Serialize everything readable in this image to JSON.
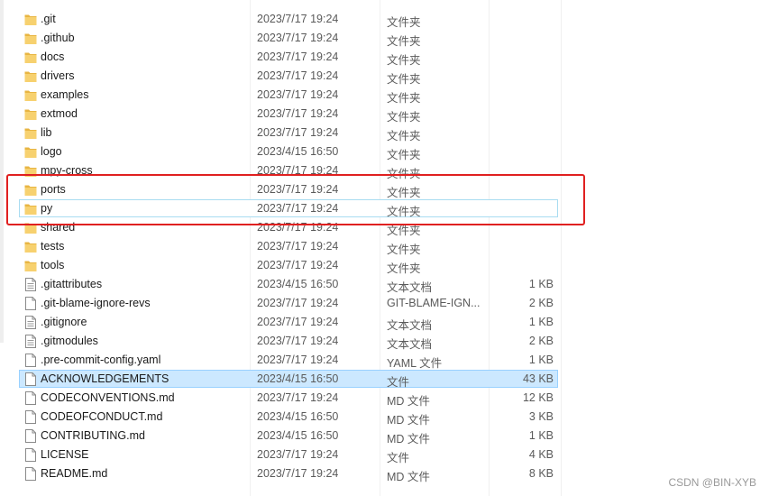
{
  "colors": {
    "folder": "#f7d16f",
    "folder_dark": "#e8b542",
    "selection": "#cce8ff",
    "highlight_box": "#e02020"
  },
  "files": [
    {
      "name": ".git",
      "date": "2023/7/17 19:24",
      "type": "文件夹",
      "size": "",
      "icon": "folder-icon"
    },
    {
      "name": ".github",
      "date": "2023/7/17 19:24",
      "type": "文件夹",
      "size": "",
      "icon": "folder-icon"
    },
    {
      "name": "docs",
      "date": "2023/7/17 19:24",
      "type": "文件夹",
      "size": "",
      "icon": "folder-icon"
    },
    {
      "name": "drivers",
      "date": "2023/7/17 19:24",
      "type": "文件夹",
      "size": "",
      "icon": "folder-icon"
    },
    {
      "name": "examples",
      "date": "2023/7/17 19:24",
      "type": "文件夹",
      "size": "",
      "icon": "folder-icon"
    },
    {
      "name": "extmod",
      "date": "2023/7/17 19:24",
      "type": "文件夹",
      "size": "",
      "icon": "folder-icon"
    },
    {
      "name": "lib",
      "date": "2023/7/17 19:24",
      "type": "文件夹",
      "size": "",
      "icon": "folder-icon"
    },
    {
      "name": "logo",
      "date": "2023/4/15 16:50",
      "type": "文件夹",
      "size": "",
      "icon": "folder-icon"
    },
    {
      "name": "mpy-cross",
      "date": "2023/7/17 19:24",
      "type": "文件夹",
      "size": "",
      "icon": "folder-icon"
    },
    {
      "name": "ports",
      "date": "2023/7/17 19:24",
      "type": "文件夹",
      "size": "",
      "icon": "folder-icon"
    },
    {
      "name": "py",
      "date": "2023/7/17 19:24",
      "type": "文件夹",
      "size": "",
      "icon": "folder-icon"
    },
    {
      "name": "shared",
      "date": "2023/7/17 19:24",
      "type": "文件夹",
      "size": "",
      "icon": "folder-icon"
    },
    {
      "name": "tests",
      "date": "2023/7/17 19:24",
      "type": "文件夹",
      "size": "",
      "icon": "folder-icon"
    },
    {
      "name": "tools",
      "date": "2023/7/17 19:24",
      "type": "文件夹",
      "size": "",
      "icon": "folder-icon"
    },
    {
      "name": ".gitattributes",
      "date": "2023/4/15 16:50",
      "type": "文本文档",
      "size": "1 KB",
      "icon": "text-document-icon"
    },
    {
      "name": ".git-blame-ignore-revs",
      "date": "2023/7/17 19:24",
      "type": "GIT-BLAME-IGN...",
      "size": "2 KB",
      "icon": "file-icon"
    },
    {
      "name": ".gitignore",
      "date": "2023/7/17 19:24",
      "type": "文本文档",
      "size": "1 KB",
      "icon": "text-document-icon"
    },
    {
      "name": ".gitmodules",
      "date": "2023/7/17 19:24",
      "type": "文本文档",
      "size": "2 KB",
      "icon": "text-document-icon"
    },
    {
      "name": ".pre-commit-config.yaml",
      "date": "2023/7/17 19:24",
      "type": "YAML 文件",
      "size": "1 KB",
      "icon": "file-icon"
    },
    {
      "name": "ACKNOWLEDGEMENTS",
      "date": "2023/4/15 16:50",
      "type": "文件",
      "size": "43 KB",
      "icon": "file-icon"
    },
    {
      "name": "CODECONVENTIONS.md",
      "date": "2023/7/17 19:24",
      "type": "MD 文件",
      "size": "12 KB",
      "icon": "file-icon"
    },
    {
      "name": "CODEOFCONDUCT.md",
      "date": "2023/4/15 16:50",
      "type": "MD 文件",
      "size": "3 KB",
      "icon": "file-icon"
    },
    {
      "name": "CONTRIBUTING.md",
      "date": "2023/4/15 16:50",
      "type": "MD 文件",
      "size": "1 KB",
      "icon": "file-icon"
    },
    {
      "name": "LICENSE",
      "date": "2023/7/17 19:24",
      "type": "文件",
      "size": "4 KB",
      "icon": "file-icon"
    },
    {
      "name": "README.md",
      "date": "2023/7/17 19:24",
      "type": "MD 文件",
      "size": "8 KB",
      "icon": "file-icon"
    }
  ],
  "watermark": "CSDN @BIN-XYB"
}
